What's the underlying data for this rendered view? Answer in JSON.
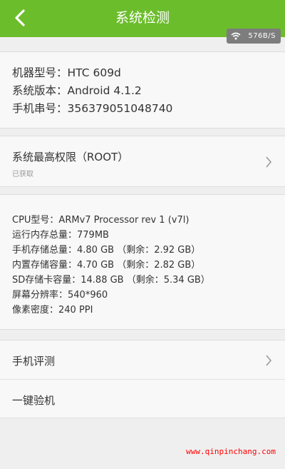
{
  "header": {
    "title": "系统检测",
    "back_icon": "chevron-left-icon",
    "bg_color": "#6cbd2c"
  },
  "status_overlay": {
    "speed": "576B/S",
    "icon": "wifi-icon"
  },
  "device_info": {
    "model": "机器型号：HTC 609d",
    "version": "系统版本：Android 4.1.2",
    "serial": "手机串号：356379051048740"
  },
  "root_row": {
    "title": "系统最高权限（ROOT）",
    "subtitle": "已获取"
  },
  "hardware_info": {
    "cpu": "CPU型号：ARMv7 Processor rev 1 (v7l)",
    "ram": "运行内存总量：779MB",
    "storage_total": "手机存储总量：4.80 GB （剩余：2.92 GB）",
    "internal": "内置存储容量：4.70 GB （剩余：2.82 GB）",
    "sd": "SD存储卡容量：14.88 GB （剩余：5.34 GB）",
    "resolution": "屏幕分辨率：540*960",
    "density": "像素密度：240 PPI"
  },
  "menu": {
    "benchmark": "手机评测",
    "one_key_check": "一键验机"
  },
  "watermark": "www.qinpinchang.com"
}
